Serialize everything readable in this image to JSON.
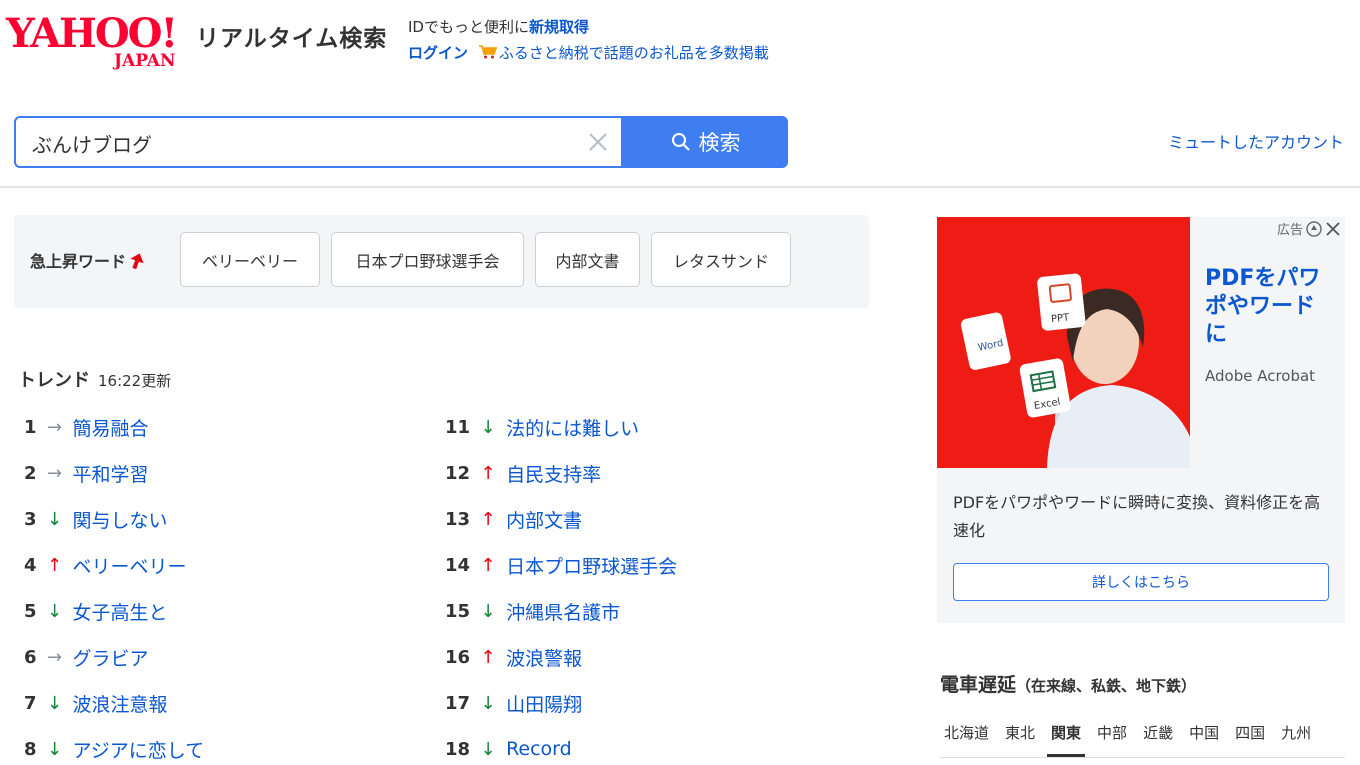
{
  "header": {
    "logo_text": "YAHOO!",
    "logo_sub": "JAPAN",
    "service_name": "リアルタイム検索",
    "promo_line1_prefix": "IDでもっと便利に",
    "promo_register": "新規取得",
    "promo_login": "ログイン",
    "promo_furusato": "ふるさと納税で話題のお礼品を多数掲載"
  },
  "search": {
    "query": "ぶんけブログ",
    "button_label": "検索",
    "muted_accounts": "ミュートしたアカウント"
  },
  "rising": {
    "label": "急上昇ワード",
    "chips": [
      "ベリーベリー",
      "日本プロ野球選手会",
      "内部文書",
      "レタスサンド"
    ]
  },
  "trend": {
    "title": "トレンド",
    "updated": "16:22更新",
    "items": [
      {
        "rank": "1",
        "arrow": "→",
        "word": "簡易融合"
      },
      {
        "rank": "2",
        "arrow": "→",
        "word": "平和学習"
      },
      {
        "rank": "3",
        "arrow": "↓",
        "word": "関与しない"
      },
      {
        "rank": "4",
        "arrow": "↑",
        "word": "ベリーベリー"
      },
      {
        "rank": "5",
        "arrow": "↓",
        "word": "女子高生と"
      },
      {
        "rank": "6",
        "arrow": "→",
        "word": "グラビア"
      },
      {
        "rank": "7",
        "arrow": "↓",
        "word": "波浪注意報"
      },
      {
        "rank": "8",
        "arrow": "↓",
        "word": "アジアに恋して"
      },
      {
        "rank": "11",
        "arrow": "↓",
        "word": "法的には難しい"
      },
      {
        "rank": "12",
        "arrow": "↑",
        "word": "自民支持率"
      },
      {
        "rank": "13",
        "arrow": "↑",
        "word": "内部文書"
      },
      {
        "rank": "14",
        "arrow": "↑",
        "word": "日本プロ野球選手会"
      },
      {
        "rank": "15",
        "arrow": "↓",
        "word": "沖縄県名護市"
      },
      {
        "rank": "16",
        "arrow": "↑",
        "word": "波浪警報"
      },
      {
        "rank": "17",
        "arrow": "↓",
        "word": "山田陽翔"
      },
      {
        "rank": "18",
        "arrow": "↓",
        "word": "Record"
      }
    ]
  },
  "ad": {
    "label": "広告",
    "headline": "PDFをパワポやワードに",
    "brand": "Adobe Acrobat",
    "description": "PDFをパワポやワードに瞬時に変換、資料修正を高速化",
    "cta": "詳しくはこちら",
    "doc_labels": [
      "Word",
      "PPT",
      "Excel"
    ]
  },
  "train": {
    "title": "電車遅延",
    "subtitle": "（在来線、私鉄、地下鉄）",
    "regions": [
      "北海道",
      "東北",
      "関東",
      "中部",
      "近畿",
      "中国",
      "四国",
      "九州"
    ],
    "active_region": "関東"
  },
  "colors": {
    "brand_red": "#ff0033",
    "link_blue": "#0b57d0",
    "search_blue": "#3f7ef2",
    "up_red": "#e60012",
    "down_green": "#16853a"
  }
}
